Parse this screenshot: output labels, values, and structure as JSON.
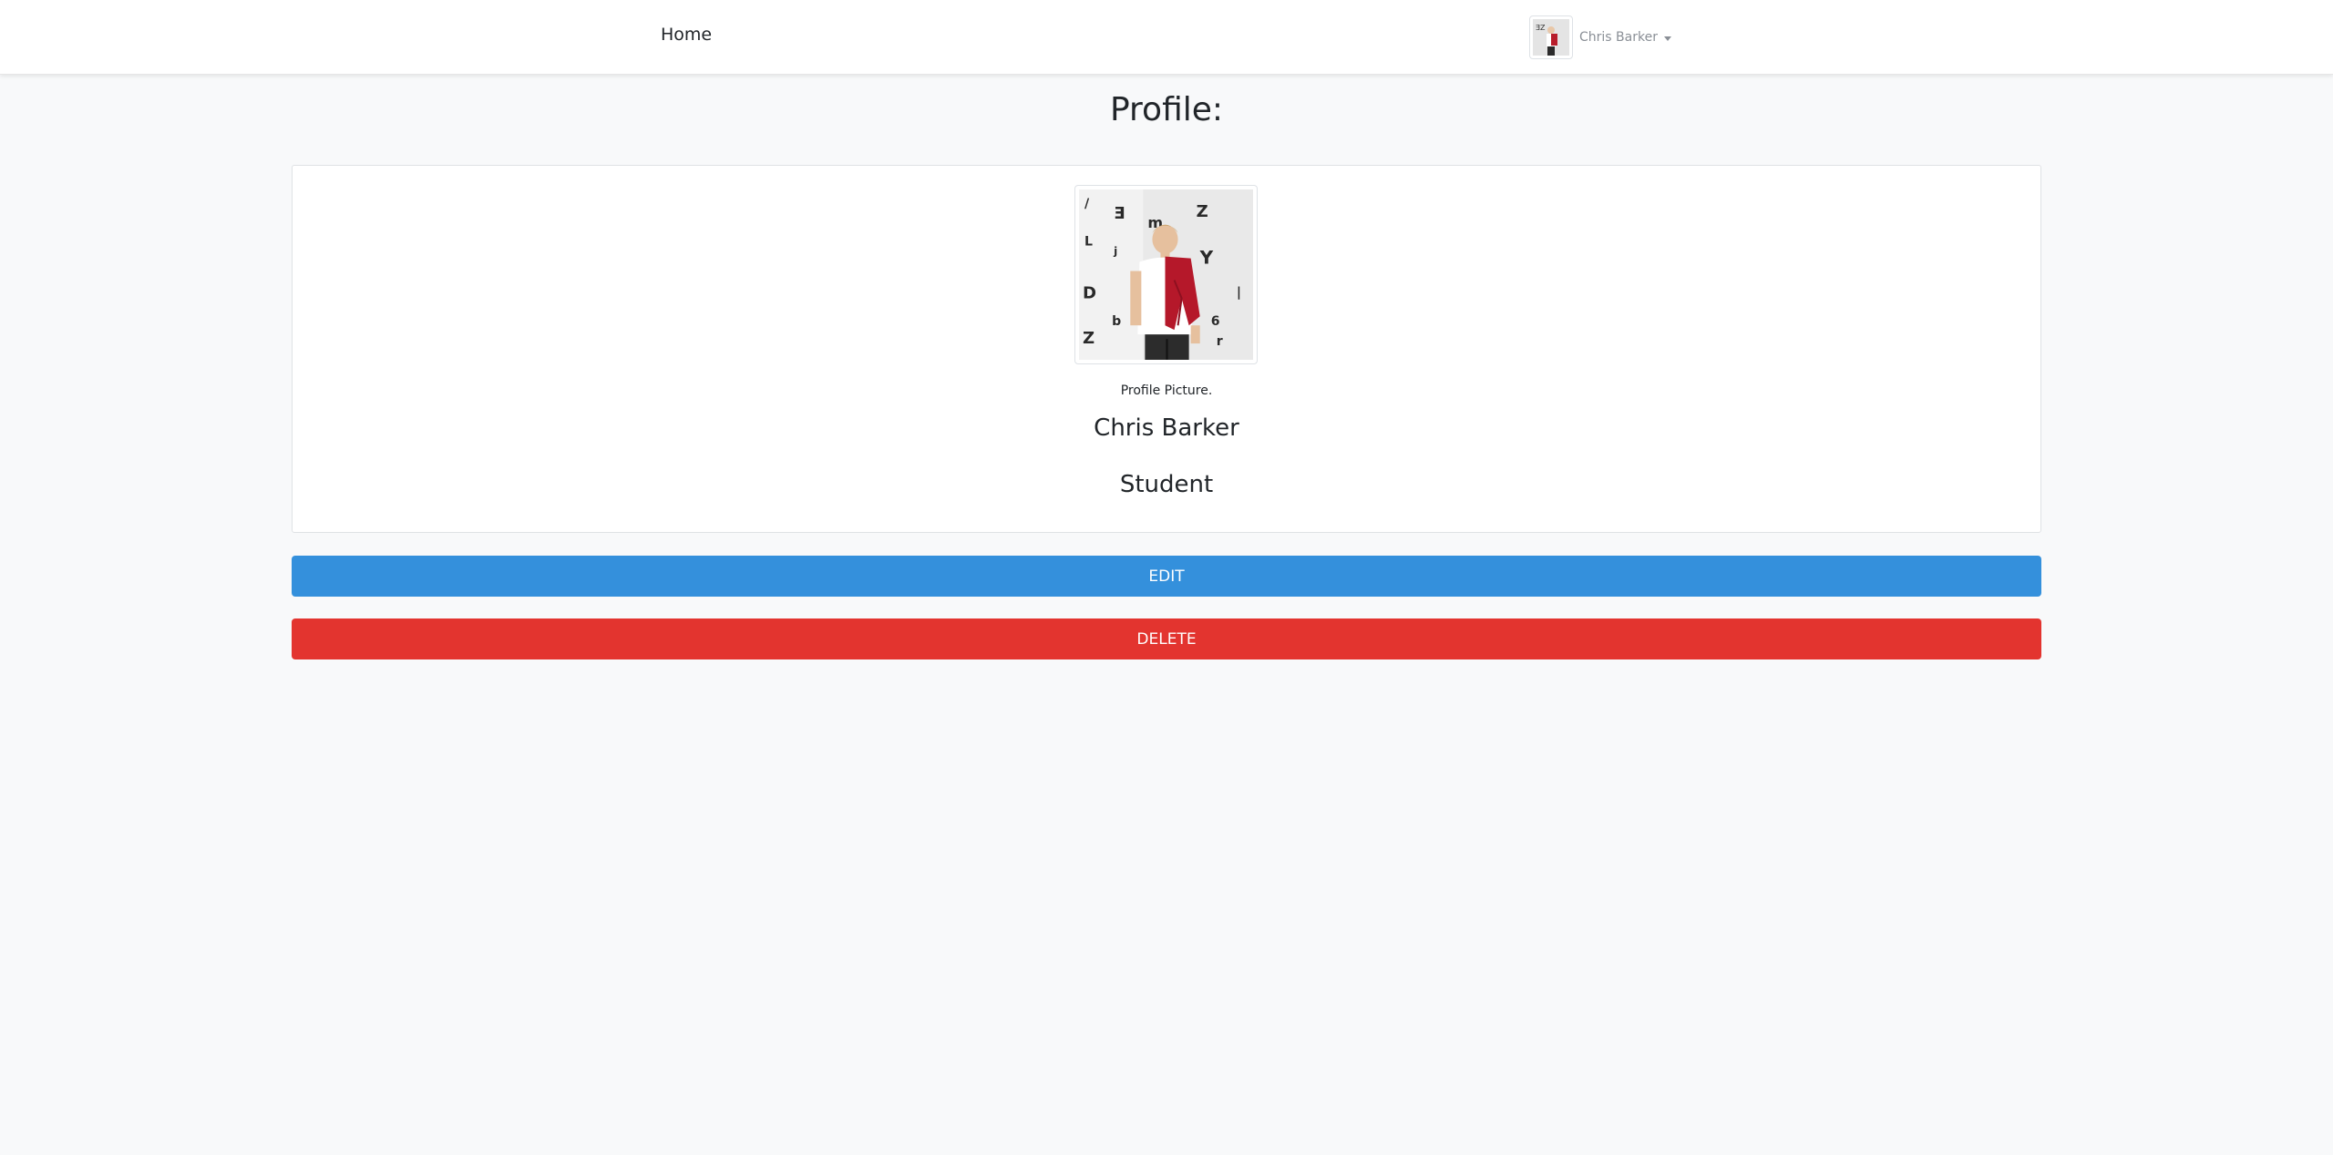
{
  "navbar": {
    "home_label": "Home",
    "user_name": "Chris Barker",
    "avatar_icon": "user-photo"
  },
  "page": {
    "title": "Profile:"
  },
  "profile": {
    "picture_caption": "Profile Picture.",
    "name": "Chris Barker",
    "role": "Student"
  },
  "actions": {
    "edit_label": "EDIT",
    "delete_label": "DELETE"
  },
  "colors": {
    "edit": "#3490dc",
    "delete": "#e3342f",
    "background": "#f8f9fa"
  }
}
